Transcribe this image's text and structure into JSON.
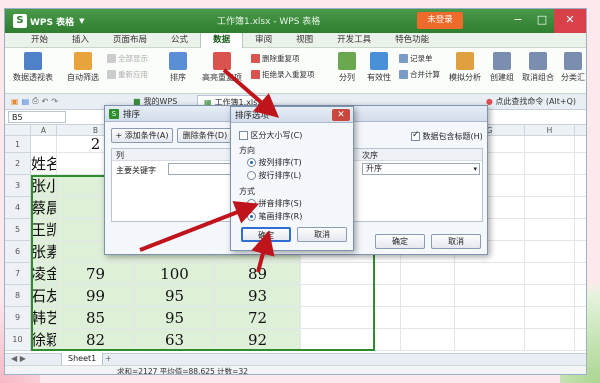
{
  "app": {
    "logo": "WPS 表格",
    "doc_title": "工作簿1.xlsx - WPS 表格",
    "login": "未登录"
  },
  "menu": [
    "开始",
    "插入",
    "页面布局",
    "公式",
    "数据",
    "审阅",
    "视图",
    "开发工具",
    "特色功能"
  ],
  "active_menu": "数据",
  "ribbon": {
    "pivot": "数据透视表",
    "autofilter": "自动筛选",
    "show_all": "全部显示",
    "reapply": "重新应用",
    "sort": "排序",
    "advanced": "高亮重复项",
    "delete_dup": "删除重复项",
    "reject_dup": "拒绝录入重复项",
    "split": "分列",
    "validity": "有效性",
    "record": "记录单",
    "merge": "合并计算",
    "simulate": "模拟分析",
    "create_group": "创建组",
    "ungroup": "取消组合",
    "subtotal": "分类汇"
  },
  "tabs": {
    "mywps": "我的WPS",
    "doc": "工作簿1.xlsx",
    "search": "点此查找命令 (Alt+Q)"
  },
  "cell_ref": "B5",
  "columns": [
    "A",
    "B",
    "C",
    "D",
    "E",
    "F",
    "G",
    "H",
    "I"
  ],
  "rows": [
    {
      "n": "1",
      "name": "",
      "c1": "2",
      "c2": "",
      "c3": ""
    },
    {
      "n": "2",
      "name": "姓名",
      "c1": "",
      "c2": "",
      "c3": ""
    },
    {
      "n": "3",
      "name": "张小琴",
      "c1": "",
      "c2": "",
      "c3": ""
    },
    {
      "n": "4",
      "name": "蔡晨曦",
      "c1": "",
      "c2": "",
      "c3": ""
    },
    {
      "n": "5",
      "name": "王凯",
      "c1": "",
      "c2": "",
      "c3": ""
    },
    {
      "n": "6",
      "name": "张素青",
      "c1": "",
      "c2": "",
      "c3": ""
    },
    {
      "n": "7",
      "name": "凌金星",
      "c1": "79",
      "c2": "100",
      "c3": "89"
    },
    {
      "n": "8",
      "name": "石友佳",
      "c1": "99",
      "c2": "95",
      "c3": "93"
    },
    {
      "n": "9",
      "name": "韩艺林",
      "c1": "85",
      "c2": "95",
      "c3": "72"
    },
    {
      "n": "10",
      "name": "徐颖",
      "c1": "82",
      "c2": "63",
      "c3": "92"
    }
  ],
  "sheet_tab": "Sheet1",
  "status": "求和=2127  平均值=88.625  计数=32",
  "sort_dialog": {
    "title": "排序",
    "add": "添加条件(A)",
    "delete": "删除条件(D)",
    "col_header": "列",
    "order_header": "次序",
    "main_key": "主要关键字",
    "order_value": "升序",
    "header_checkbox": "数据包含标题(H)",
    "ok": "确定",
    "cancel": "取消"
  },
  "options_dialog": {
    "title": "排序选项",
    "case_sensitive": "区分大小写(C)",
    "direction": "方向",
    "by_col": "按列排序(T)",
    "by_row": "按行排序(L)",
    "method": "方式",
    "pinyin": "拼音排序(S)",
    "stroke": "笔画排序(R)",
    "ok": "确定",
    "cancel": "取消"
  }
}
